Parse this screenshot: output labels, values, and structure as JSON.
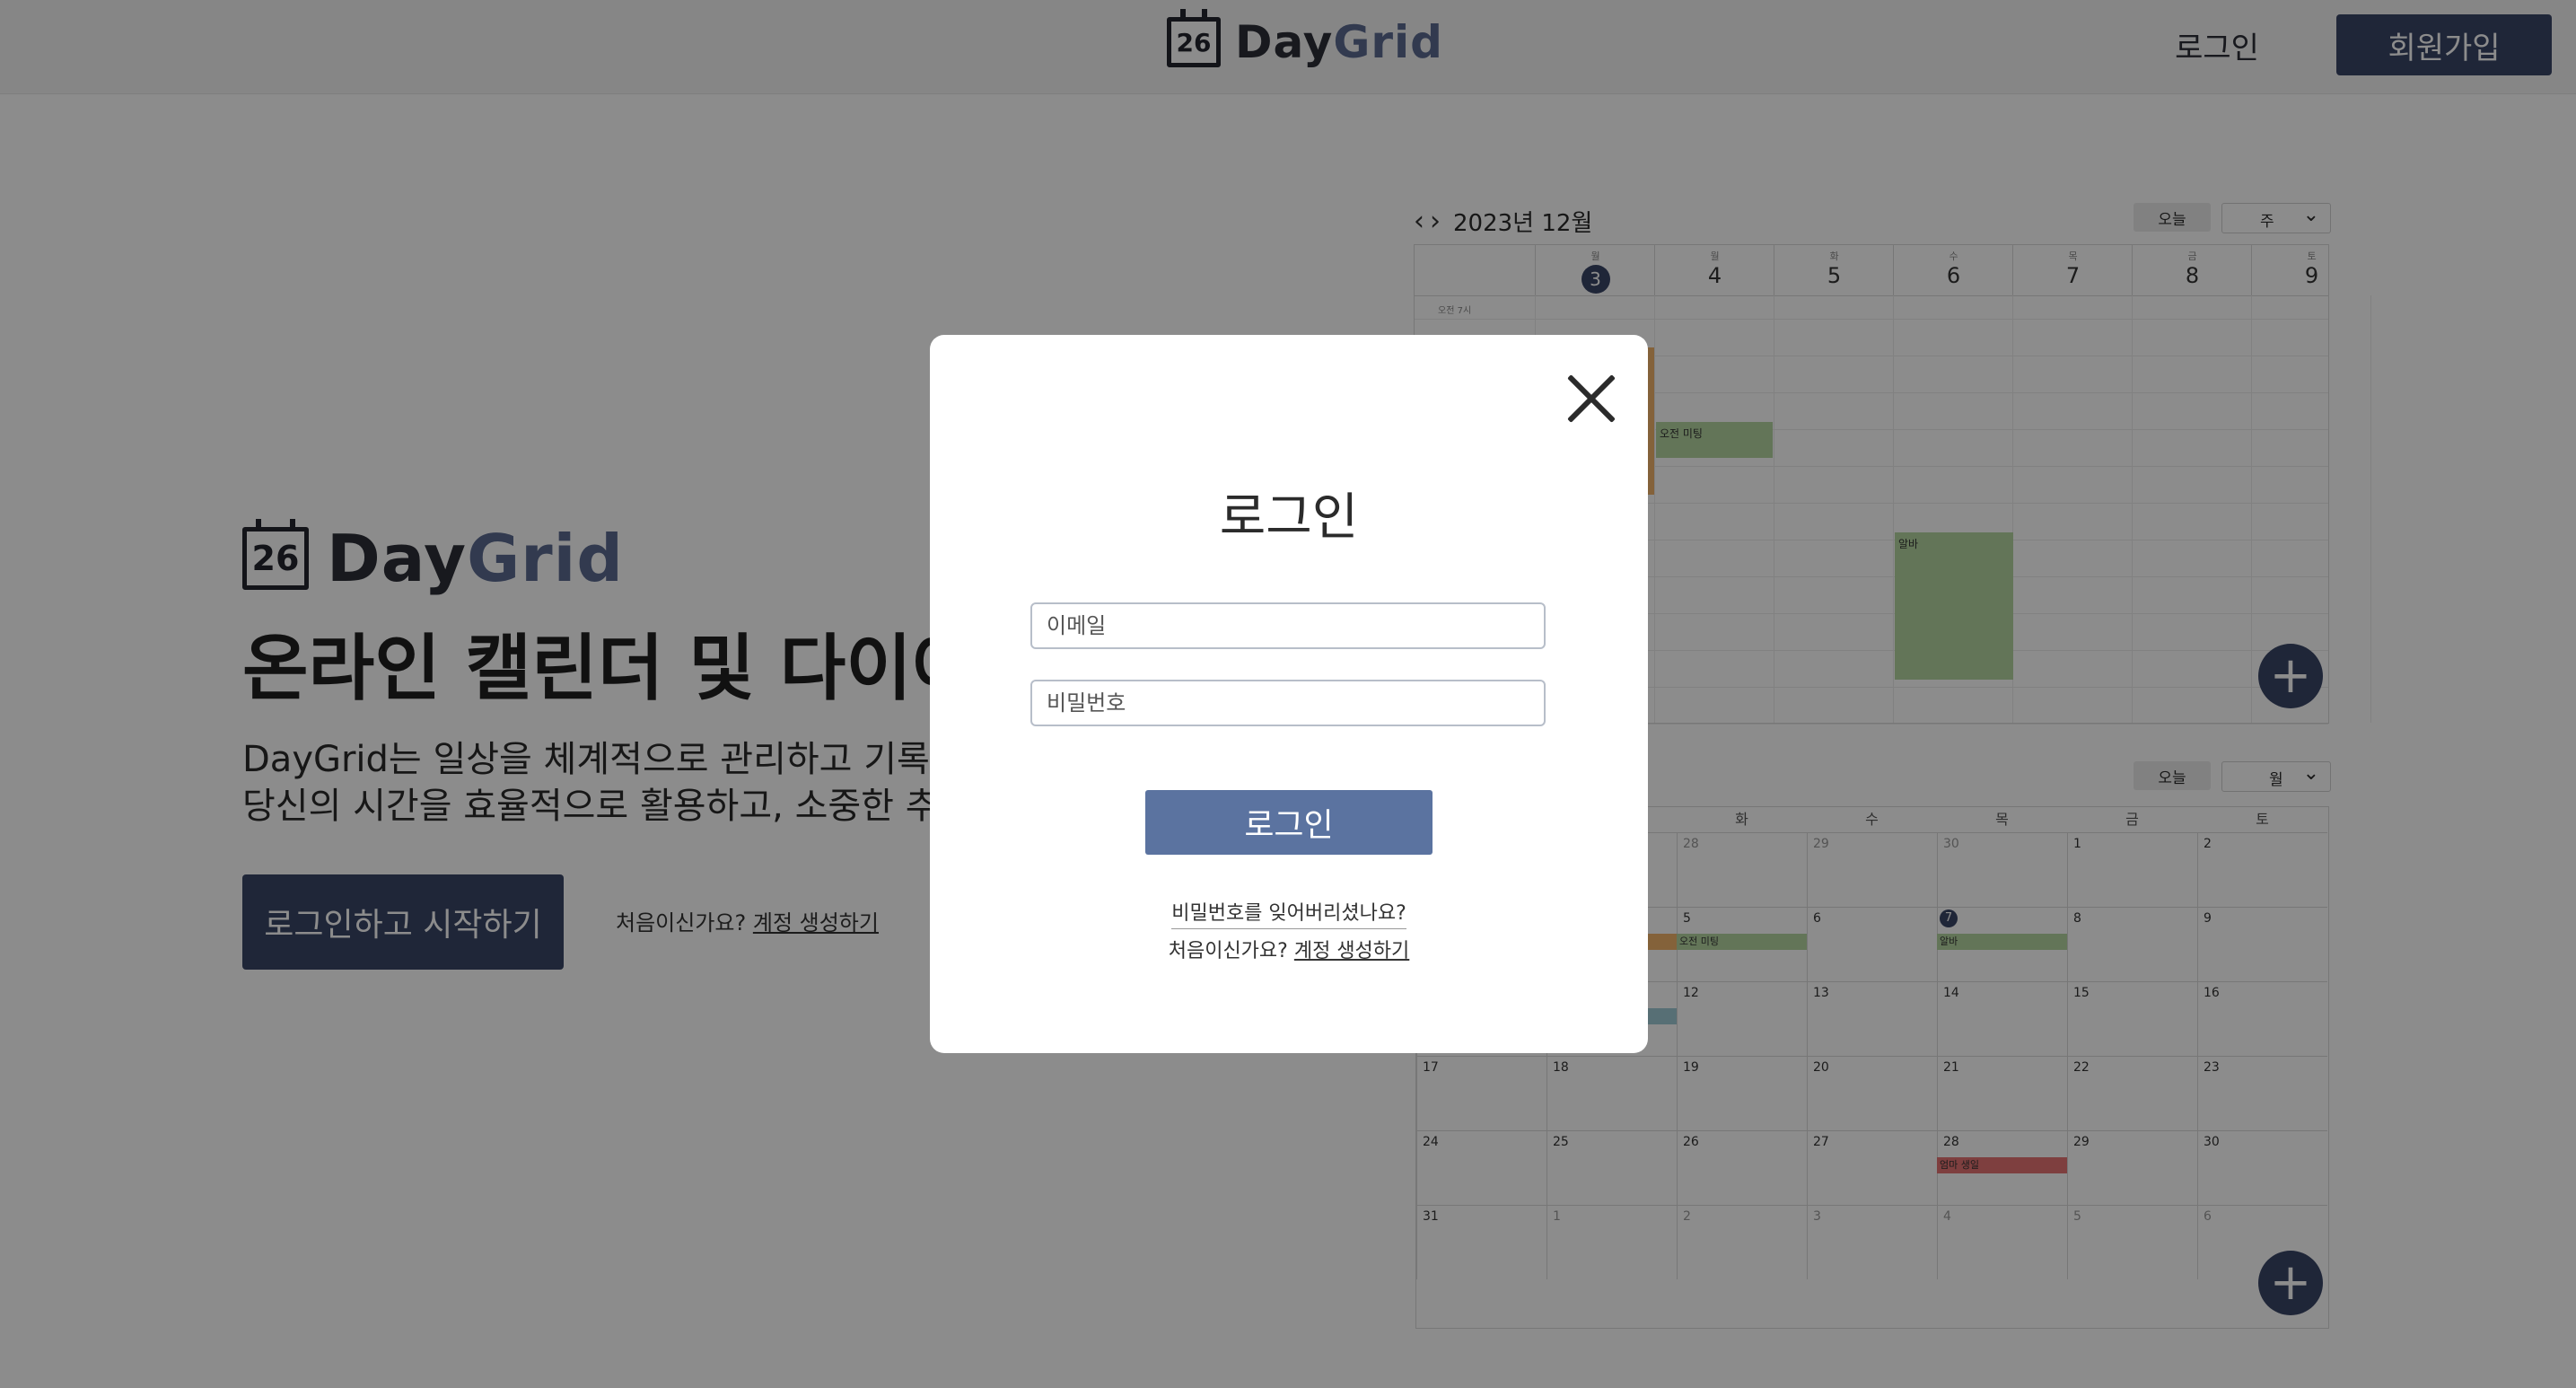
{
  "brand": {
    "calendar_number": "26",
    "name_part1": "Day",
    "name_part2": "Grid"
  },
  "header": {
    "login_label": "로그인",
    "signup_label": "회원가입"
  },
  "hero": {
    "title": "온라인 캘린더 및 다이어",
    "description_line1": "DayGrid는 일상을 체계적으로 관리하고 기록",
    "description_line2": "당신의 시간을 효율적으로 활용하고, 소중한 추",
    "cta_label": "로그인하고 시작하기",
    "new_user_prompt": "처음이신가요?",
    "create_account_link": "계정 생성하기"
  },
  "week_calendar": {
    "prev_icon": "‹",
    "next_icon": "›",
    "title": "2023년 12월",
    "today_label": "오늘",
    "view_select": "주",
    "days": [
      {
        "dow": "월",
        "num": "3",
        "today": true
      },
      {
        "dow": "월",
        "num": "4"
      },
      {
        "dow": "화",
        "num": "5"
      },
      {
        "dow": "수",
        "num": "6"
      },
      {
        "dow": "목",
        "num": "7"
      },
      {
        "dow": "금",
        "num": "8"
      },
      {
        "dow": "토",
        "num": "9"
      }
    ],
    "time_label": "오전 7시",
    "events": [
      {
        "title": "",
        "color": "#f0b26a"
      },
      {
        "title": "오전 미팅",
        "color": "#b5d6a0"
      },
      {
        "title": "알바",
        "color": "#b5d6a0"
      }
    ],
    "fab_icon": "+"
  },
  "month_calendar": {
    "today_label": "오늘",
    "view_select": "월",
    "headers": [
      "",
      "",
      "화",
      "수",
      "목",
      "금",
      "토"
    ],
    "weeks": [
      [
        "",
        "",
        "28",
        "29",
        "30",
        "1",
        "2"
      ],
      [
        "",
        "",
        "5",
        "6",
        "7",
        "8",
        "9"
      ],
      [
        "",
        "",
        "12",
        "13",
        "14",
        "15",
        "16"
      ],
      [
        "17",
        "18",
        "19",
        "20",
        "21",
        "22",
        "23"
      ],
      [
        "24",
        "25",
        "26",
        "27",
        "28",
        "29",
        "30"
      ],
      [
        "31",
        "1",
        "2",
        "3",
        "4",
        "5",
        "6"
      ]
    ],
    "events": [
      {
        "title": "오전 미팅",
        "color": "#b5d6a0"
      },
      {
        "title": "알바",
        "color": "#b5d6a0"
      },
      {
        "title": "엄마 생일",
        "color": "#e57373"
      }
    ],
    "fab_icon": "+"
  },
  "modal": {
    "title": "로그인",
    "email_placeholder": "이메일",
    "password_placeholder": "비밀번호",
    "login_button": "로그인",
    "forgot_password": "비밀번호를 잊어버리셨나요?",
    "new_user_prompt": "처음이신가요?",
    "create_account_link": "계정 생성하기"
  }
}
